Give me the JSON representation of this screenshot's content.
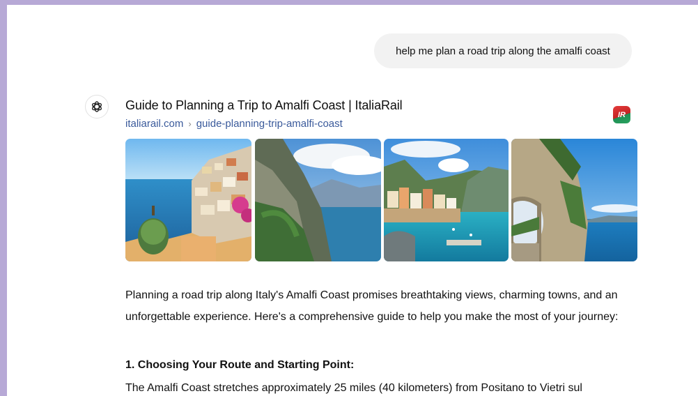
{
  "user_message": "help me plan a road trip along the amalfi coast",
  "assistant": {
    "avatar_icon": "openai-logo-icon",
    "search_result": {
      "title": "Guide to Planning a Trip to Amalfi Coast | ItaliaRail",
      "domain": "italiarail.com",
      "separator": "›",
      "path": "guide-planning-trip-amalfi-coast",
      "favicon_text": "IR",
      "favicon_colors": [
        "#e43b3b",
        "#29a35f"
      ],
      "images": [
        "positano-coast-photo",
        "coastal-cliffs-photo",
        "harbor-village-photo",
        "cliff-tunnel-road-photo"
      ]
    },
    "intro": "Planning a road trip along Italy's Amalfi Coast promises breathtaking views, charming towns, and an unforgettable experience. Here's a comprehensive guide to help you make the most of your journey:",
    "section1_heading": "1. Choosing Your Route and Starting Point:",
    "section1_text": "The Amalfi Coast stretches approximately 25 miles (40 kilometers) from Positano to Vietri sul"
  }
}
